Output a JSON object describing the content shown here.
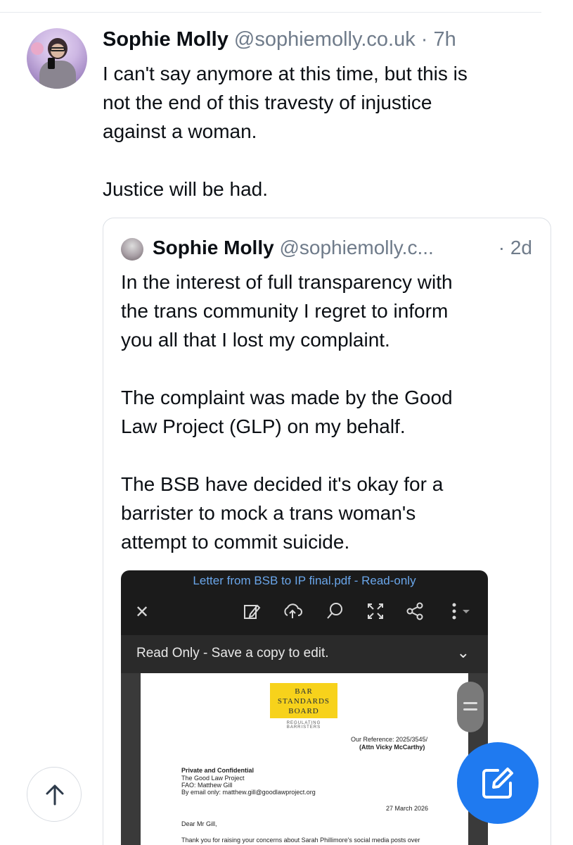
{
  "post": {
    "author_name": "Sophie Molly",
    "handle": "@sophiemolly.co.uk",
    "separator": "·",
    "time": "7h",
    "text_line1": "I can't say anymore at this time, but this is",
    "text_line2": "not the end of this travesty of injustice",
    "text_line3": "against a woman.",
    "text_line4": "Justice will be had."
  },
  "quote": {
    "author_name": "Sophie Molly",
    "handle": "@sophiemolly.c...",
    "time": "· 2d",
    "lines": [
      "In the interest of full transparency with",
      "the trans community I regret to inform",
      "you all that I lost my complaint.",
      "The complaint was made by the Good",
      "Law Project (GLP) on my behalf.",
      "The BSB have decided it's okay for a",
      "barrister to mock a trans woman's",
      "attempt to commit suicide."
    ]
  },
  "embed": {
    "file_title": "Letter from BSB to IP final.pdf - Read-only",
    "readonly_bar": "Read Only - Save a copy to edit.",
    "logo_line1": "BAR",
    "logo_line2": "STANDARDS",
    "logo_line3": "BOARD",
    "logo_tagline": "REGULATING BARRISTERS",
    "reference": "Our Reference: 2025/3545/",
    "attn": "(Attn Vicky McCarthy)",
    "private": "Private and Confidential",
    "addr1": "The Good Law Project",
    "addr2": "FAO: Matthew Gill",
    "addr3": "By email only: matthew.gill@goodlawproject.org",
    "date": "27 March 2026",
    "salutation": "Dear Mr Gill,",
    "body_start": "Thank you for raising your concerns about Sarah Phillimore's social media posts over"
  },
  "icons": {
    "close": "close-icon",
    "annotate": "pen-edit-icon",
    "upload": "cloud-upload-icon",
    "search": "search-icon",
    "fullscreen": "expand-icon",
    "share": "share-icon",
    "more": "more-vertical-icon",
    "scroll_up": "arrow-up-icon",
    "compose": "compose-icon"
  },
  "colors": {
    "accent": "#1f7af0",
    "handle_gray": "#6f7b8a",
    "pdf_link": "#6aa6ea",
    "logo_yellow": "#f7d21b"
  }
}
